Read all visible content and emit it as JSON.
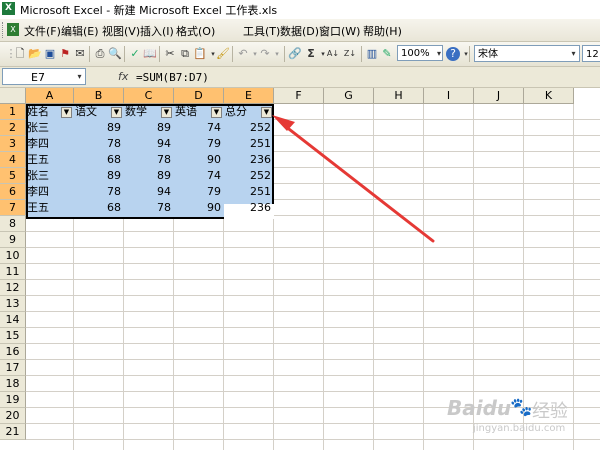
{
  "window": {
    "title": "Microsoft Excel - 新建 Microsoft Excel 工作表.xls"
  },
  "menu": {
    "items": [
      "文件(F)",
      "编辑(E)",
      "视图(V)",
      "插入(I)",
      "格式(O)",
      "工具(T)",
      "数据(D)",
      "窗口(W)",
      "帮助(H)"
    ]
  },
  "toolbar": {
    "zoom": "100%",
    "font_name": "宋体",
    "font_size": "12"
  },
  "formula_bar": {
    "name_box": "E7",
    "fx_label": "fx",
    "formula": "=SUM(B7:D7)"
  },
  "sheet": {
    "columns": [
      "A",
      "B",
      "C",
      "D",
      "E",
      "F",
      "G",
      "H",
      "I",
      "J",
      "K"
    ],
    "selected_columns": [
      "A",
      "B",
      "C",
      "D",
      "E"
    ],
    "rows": [
      "1",
      "2",
      "3",
      "4",
      "5",
      "6",
      "7",
      "8",
      "9",
      "10",
      "11",
      "12",
      "13",
      "14",
      "15",
      "16",
      "17",
      "18",
      "19",
      "20",
      "21"
    ],
    "selected_rows": [
      "1",
      "2",
      "3",
      "4",
      "5",
      "6",
      "7"
    ],
    "header_row": [
      "姓名",
      "语文",
      "数学",
      "英语",
      "总分"
    ],
    "data_rows": [
      [
        "张三",
        "89",
        "89",
        "74",
        "252"
      ],
      [
        "李四",
        "78",
        "94",
        "79",
        "251"
      ],
      [
        "王五",
        "68",
        "78",
        "90",
        "236"
      ],
      [
        "张三",
        "89",
        "89",
        "74",
        "252"
      ],
      [
        "李四",
        "78",
        "94",
        "79",
        "251"
      ],
      [
        "王五",
        "68",
        "78",
        "90",
        "236"
      ]
    ]
  },
  "annotation": {
    "arrow_color": "#e53935"
  },
  "watermark": {
    "brand": "Baidu",
    "brand_cn": "经验",
    "url": "jingyan.baidu.com"
  }
}
